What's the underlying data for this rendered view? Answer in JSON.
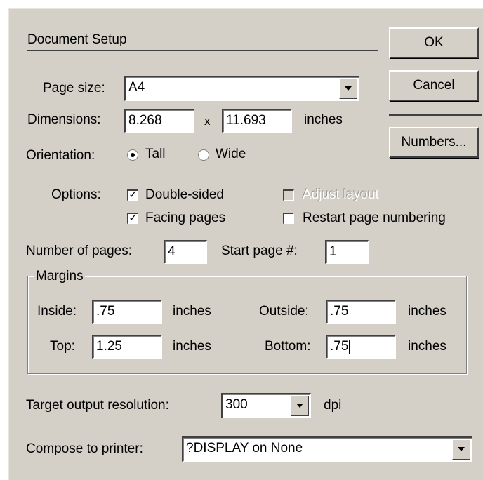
{
  "dialog": {
    "title": "Document Setup",
    "buttons": {
      "ok": "OK",
      "cancel": "Cancel",
      "numbers": "Numbers..."
    },
    "page_size": {
      "label": "Page size:",
      "value": "A4"
    },
    "dimensions": {
      "label": "Dimensions:",
      "width": "8.268",
      "times": "x",
      "height": "11.693",
      "unit": "inches"
    },
    "orientation": {
      "label": "Orientation:",
      "tall": "Tall",
      "wide": "Wide",
      "selected": "Tall"
    },
    "options": {
      "label": "Options:",
      "double_sided": {
        "label": "Double-sided",
        "checked": true
      },
      "facing_pages": {
        "label": "Facing pages",
        "checked": true
      },
      "adjust_layout": {
        "label": "Adjust layout",
        "checked": false,
        "disabled": true
      },
      "restart_numbering": {
        "label": "Restart page numbering",
        "checked": false
      }
    },
    "number_of_pages": {
      "label": "Number of pages:",
      "value": "4"
    },
    "start_page": {
      "label": "Start page #:",
      "value": "1"
    },
    "margins": {
      "label": "Margins",
      "inside": {
        "label": "Inside:",
        "value": ".75",
        "unit": "inches"
      },
      "outside": {
        "label": "Outside:",
        "value": ".75",
        "unit": "inches"
      },
      "top": {
        "label": "Top:",
        "value": "1.25",
        "unit": "inches"
      },
      "bottom": {
        "label": "Bottom:",
        "value": ".75",
        "unit": "inches"
      }
    },
    "resolution": {
      "label": "Target output resolution:",
      "value": "300",
      "unit": "dpi"
    },
    "printer": {
      "label": "Compose to printer:",
      "value": "?DISPLAY on None"
    },
    "check_mark": "✓"
  }
}
